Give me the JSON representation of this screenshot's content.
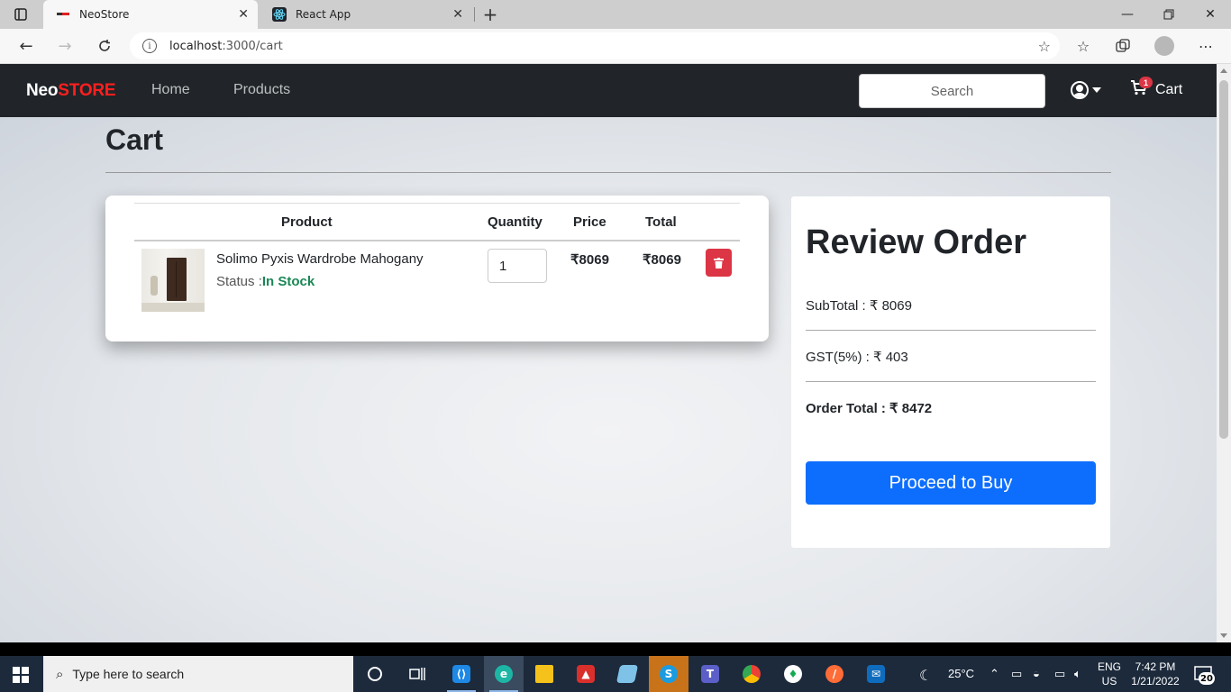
{
  "browser": {
    "tabs": [
      {
        "title": "NeoStore"
      },
      {
        "title": "React App"
      }
    ],
    "url_host": "localhost",
    "url_path": ":3000/cart"
  },
  "navbar": {
    "brand_neo": "Neo",
    "brand_store": "STORE",
    "links": [
      "Home",
      "Products"
    ],
    "search_placeholder": "Search",
    "cart_label": "Cart",
    "cart_count": "1"
  },
  "page": {
    "title": "Cart"
  },
  "cart": {
    "columns": [
      "Product",
      "Quantity",
      "Price",
      "Total"
    ],
    "items": [
      {
        "name": "Solimo Pyxis Wardrobe Mahogany",
        "status_label": "Status :",
        "status_value": "In Stock",
        "quantity": "1",
        "price": "₹8069",
        "total": "₹8069"
      }
    ]
  },
  "review": {
    "title": "Review Order",
    "subtotal": "SubTotal : ₹ 8069",
    "gst": "GST(5%) : ₹ 403",
    "order_total": "Order Total : ₹ 8472",
    "button": "Proceed to Buy"
  },
  "taskbar": {
    "search_placeholder": "Type here to search",
    "weather": "25°C",
    "lang_1": "ENG",
    "lang_2": "US",
    "time": "7:42 PM",
    "date": "1/21/2022",
    "notification_count": "20"
  },
  "colors": {
    "brand_red": "#ff1f1f",
    "navbar_bg": "#212529",
    "in_stock": "#198754",
    "delete": "#dc3545",
    "primary": "#0d6efd"
  }
}
